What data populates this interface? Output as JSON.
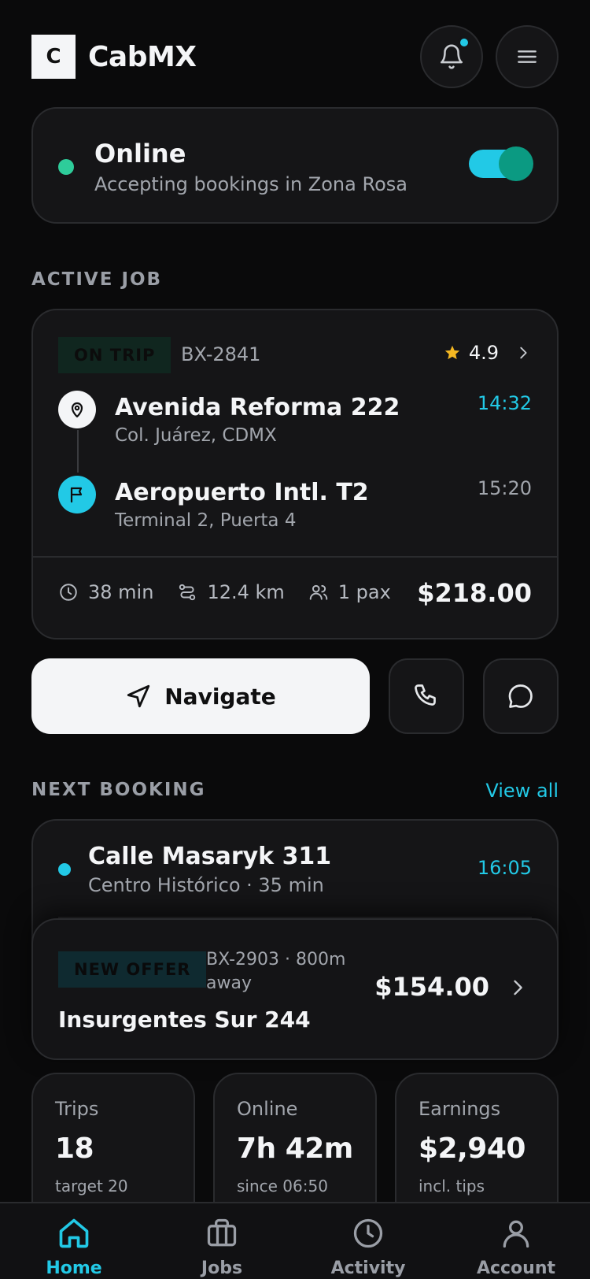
{
  "app": {
    "logo_letter": "C",
    "name": "CabMX"
  },
  "header": {
    "bell_icon": "bell-icon",
    "menu_icon": "hamburger-menu-icon",
    "has_unread": true
  },
  "status": {
    "title": "Online",
    "subtitle": "Accepting bookings in Zona Rosa",
    "online": true
  },
  "active_job": {
    "section_label": "ACTIVE JOB",
    "badge": "ON TRIP",
    "job_id": "BX-2841",
    "rating": "4.9",
    "pickup": {
      "title": "Avenida Reforma 222",
      "subtitle": "Col. Juárez, CDMX",
      "time": "14:32"
    },
    "dropoff": {
      "title": "Aeropuerto Intl. T2",
      "subtitle": "Terminal 2, Puerta 4",
      "time": "15:20"
    },
    "duration": "38 min",
    "distance": "12.4 km",
    "passengers": "1 pax",
    "fare": "$218.00"
  },
  "actions": {
    "navigate_label": "Navigate"
  },
  "next_booking": {
    "section_label": "NEXT BOOKING",
    "view_all": "View all",
    "title": "Calle Masaryk 311",
    "subtitle": "Centro Histórico · 35 min",
    "time": "16:05"
  },
  "offer": {
    "badge": "NEW OFFER",
    "meta": "BX-2903 · 800m away",
    "title": "Insurgentes Sur 244",
    "fare": "$154.00"
  },
  "stats": [
    {
      "label": "Trips",
      "value": "18",
      "sub": "target 20"
    },
    {
      "label": "Online",
      "value": "7h 42m",
      "sub": "since 06:50"
    },
    {
      "label": "Earnings",
      "value": "$2,940",
      "sub": "incl. tips"
    }
  ],
  "tabs": [
    {
      "label": "Home",
      "icon": "home-icon",
      "active": true
    },
    {
      "label": "Jobs",
      "icon": "briefcase-icon",
      "active": false
    },
    {
      "label": "Activity",
      "icon": "clock-icon",
      "active": false
    },
    {
      "label": "Account",
      "icon": "user-icon",
      "active": false
    }
  ],
  "colors": {
    "accent": "#22c9e6",
    "online": "#2ecc9a",
    "background": "#0a0a0b",
    "card": "#151517",
    "star": "#f5b822"
  }
}
